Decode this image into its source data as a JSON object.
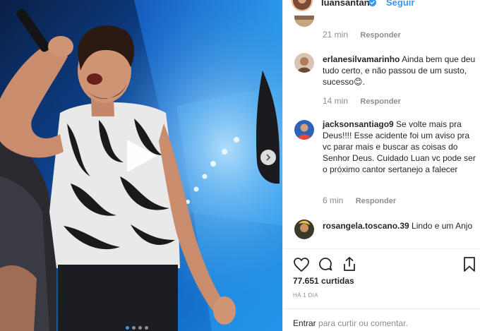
{
  "post": {
    "username": "luansantana",
    "follow_label": "Seguir",
    "likes": "77.651 curtidas",
    "posted_ago": "HÁ 1 DIA"
  },
  "comments": [
    {
      "username": "",
      "text": "",
      "time": "21 min",
      "reply_label": "Responder"
    },
    {
      "username": "erlanesilvamarinho",
      "text": " Ainda bem que deu tudo certo, e não passou de um susto, sucesso😊.",
      "time": "14 min",
      "reply_label": "Responder"
    },
    {
      "username": "jacksonsantiago9",
      "text": " Se volte mais pra Deus!!!! Esse acidente foi um aviso pra vc parar mais e buscar as coisas do Senhor Deus. Cuidado Luan vc pode ser o próximo cantor sertanejo a falecer",
      "time": "6 min",
      "reply_label": "Responder"
    },
    {
      "username": "rosangela.toscano.39",
      "text": " Lindo e um Anjo",
      "time": "",
      "reply_label": ""
    }
  ],
  "footer": {
    "login_link": "Entrar",
    "login_text": " para curtir ou comentar."
  },
  "colors": {
    "accent": "#3897f0",
    "muted": "#8e8e8e",
    "text": "#262626",
    "stage_blue": "#1e6fd0"
  },
  "icons": [
    "play-icon",
    "chevron-right-icon",
    "heart-icon",
    "comment-icon",
    "share-icon",
    "bookmark-icon",
    "verified-badge-icon"
  ],
  "media": {
    "carousel_count": 4,
    "carousel_active": 1
  }
}
